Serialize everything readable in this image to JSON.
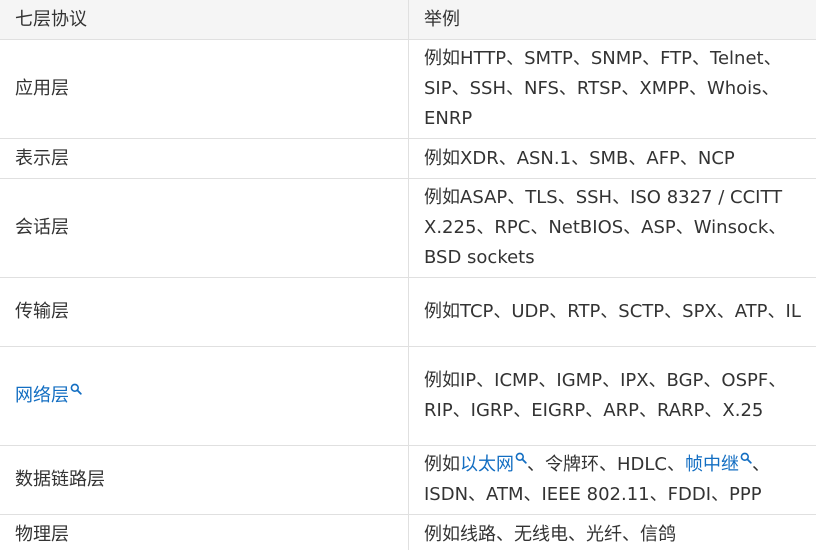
{
  "table": {
    "headers": [
      "七层协议",
      "举例"
    ],
    "rows": [
      {
        "layer": "应用层",
        "example": "例如HTTP、SMTP、SNMP、FTP、Telnet、SIP、SSH、NFS、RTSP、XMPP、Whois、ENRP"
      },
      {
        "layer": "表示层",
        "example": "例如XDR、ASN.1、SMB、AFP、NCP"
      },
      {
        "layer": "会话层",
        "example": "例如ASAP、TLS、SSH、ISO 8327 / CCITT X.225、RPC、NetBIOS、ASP、Winsock、BSD sockets"
      },
      {
        "layer": "传输层",
        "example": "例如TCP、UDP、RTP、SCTP、SPX、ATP、IL"
      },
      {
        "layer": "网络层",
        "example": "例如IP、ICMP、IGMP、IPX、BGP、OSPF、RIP、IGRP、EIGRP、ARP、RARP、X.25"
      },
      {
        "layer": "数据链路层",
        "example_prefix": "例如",
        "link_ethernet": "以太网",
        "example_mid": "、令牌环、HDLC、",
        "link_frame_relay": "帧中继",
        "example_suffix": "、ISDN、ATM、IEEE 802.11、FDDI、PPP"
      },
      {
        "layer": "物理层",
        "example": "例如线路、无线电、光纤、信鸽"
      }
    ]
  },
  "colors": {
    "link": "#136ec2",
    "header_bg": "#f5f5f5",
    "border": "#e0e0e0",
    "text": "#333333"
  },
  "icons": {
    "link_marker": "search-icon"
  }
}
